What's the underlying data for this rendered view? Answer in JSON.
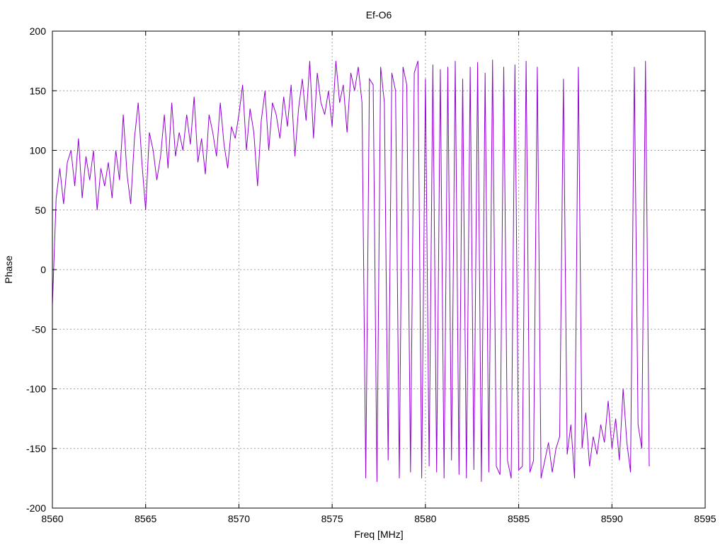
{
  "chart_data": {
    "type": "line",
    "title": "Ef-O6",
    "xlabel": "Freq [MHz]",
    "ylabel": "Phase",
    "xlim": [
      8560,
      8595
    ],
    "ylim": [
      -200,
      200
    ],
    "xticks": [
      8560,
      8565,
      8570,
      8575,
      8580,
      8585,
      8590,
      8595
    ],
    "yticks": [
      -200,
      -150,
      -100,
      -50,
      0,
      50,
      100,
      150,
      200
    ],
    "grid": true,
    "legend": "none",
    "series": [
      {
        "name": "Phase",
        "color": "#9400d3",
        "x_start": 8560,
        "x_step": 0.2,
        "y": [
          -30,
          60,
          85,
          55,
          90,
          100,
          70,
          110,
          60,
          95,
          75,
          100,
          50,
          85,
          70,
          90,
          60,
          100,
          75,
          130,
          80,
          55,
          110,
          140,
          90,
          50,
          115,
          100,
          75,
          95,
          130,
          85,
          140,
          95,
          115,
          100,
          130,
          105,
          145,
          90,
          110,
          80,
          130,
          115,
          95,
          140,
          105,
          85,
          120,
          110,
          130,
          155,
          100,
          135,
          115,
          70,
          125,
          150,
          100,
          140,
          130,
          110,
          145,
          120,
          155,
          95,
          135,
          160,
          125,
          175,
          110,
          165,
          140,
          130,
          150,
          120,
          175,
          140,
          155,
          115,
          165,
          150,
          170,
          140,
          -175,
          160,
          155,
          -178,
          170,
          140,
          -160,
          165,
          150,
          -175,
          170,
          155,
          -170,
          165,
          175,
          -175,
          160,
          -165,
          172,
          -170,
          168,
          -175,
          170,
          -160,
          175,
          -172,
          160,
          -175,
          170,
          -168,
          174,
          -178,
          165,
          -170,
          176,
          -165,
          -172,
          170,
          -160,
          -175,
          172,
          -168,
          -165,
          175,
          -170,
          -160,
          170,
          -175,
          -160,
          -145,
          -170,
          -150,
          -140,
          160,
          -155,
          -130,
          -175,
          170,
          -150,
          -120,
          -165,
          -140,
          -155,
          -130,
          -145,
          -110,
          -150,
          -125,
          -160,
          -100,
          -145,
          -170,
          170,
          -130,
          -150,
          175,
          -165
        ]
      }
    ]
  }
}
